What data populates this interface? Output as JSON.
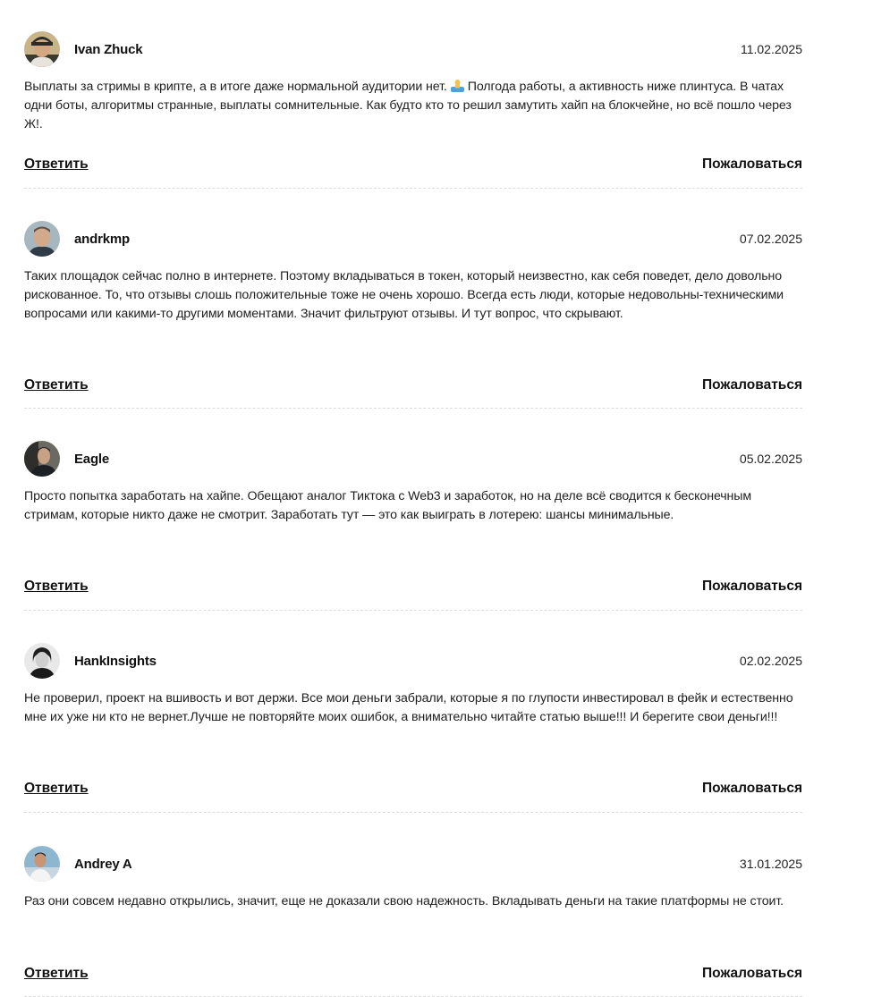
{
  "comments": [
    {
      "author": "Ivan Zhuck",
      "date": "11.02.2025",
      "text_before_emoji": "Выплаты за стримы в крипте, а в итоге даже нормальной аудитории нет.",
      "emoji": "person-in-water-emoji",
      "text_after_emoji": "Полгода работы, а активность ниже плинтуса. В чатах одни боты, алгоритмы странные, выплаты сомнительные. Как будто кто то решил замутить хайп на блокчейне, но всё пошло через Ж!.",
      "reply_label": "Ответить",
      "report_label": "Пожаловаться"
    },
    {
      "author": "andrkmp",
      "date": "07.02.2025",
      "text": "Таких площадок сейчас полно в интернете. Поэтому вкладываться в токен, который неизвестно, как себя поведет, дело довольно рискованное. То, что отзывы слошь положительные тоже не очень хорошо. Всегда есть люди, которые недовольны-техническими вопросами или какими-то другими моментами. Значит фильтруют отзывы. И тут вопрос, что скрывают.",
      "reply_label": "Ответить",
      "report_label": "Пожаловаться"
    },
    {
      "author": "Eagle",
      "date": "05.02.2025",
      "text": "Просто попытка заработать на хайпе. Обещают аналог Тиктока с Web3 и заработок, но на деле всё сводится к бесконечным стримам, которые никто даже не смотрит. Заработать тут — это как выиграть в лотерею: шансы минимальные.",
      "reply_label": "Ответить",
      "report_label": "Пожаловаться"
    },
    {
      "author": "HankInsights",
      "date": "02.02.2025",
      "text": "Не проверил, проект на вшивость и вот держи. Все мои деньги забрали, которые я по глупости инвестировал в фейк и естественно мне их уже ни кто не вернет.Лучше не повторяйте моих ошибок, а внимательно читайте статью выше!!! И берегите свои деньги!!!",
      "reply_label": "Ответить",
      "report_label": "Пожаловаться"
    },
    {
      "author": "Andrey A",
      "date": "31.01.2025",
      "text": "Раз они совсем недавно открылись, значит, еще не доказали свою надежность. Вкладывать деньги на такие платформы не стоит.",
      "reply_label": "Ответить",
      "report_label": "Пожаловаться"
    }
  ]
}
